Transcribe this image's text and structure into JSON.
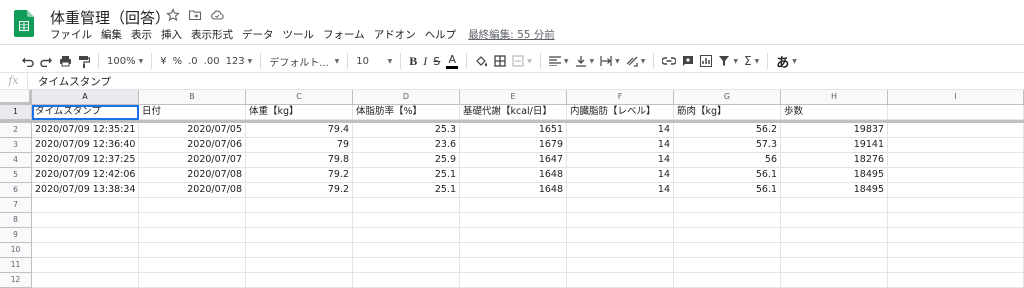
{
  "app": {
    "title": "体重管理（回答）",
    "accent_color": "#0f9d58"
  },
  "menu": {
    "items": [
      "ファイル",
      "編集",
      "表示",
      "挿入",
      "表示形式",
      "データ",
      "ツール",
      "フォーム",
      "アドオン",
      "ヘルプ"
    ],
    "last_edit": "最終編集: 55 分前"
  },
  "toolbar": {
    "zoom": "100%",
    "currency": "¥",
    "percent": "%",
    "decimal_dec": ".0",
    "decimal_inc": ".00",
    "format_more": "123",
    "font": "デフォルト...",
    "font_size": "10",
    "bold": "B",
    "italic": "I",
    "strike": "S",
    "text_color": "A",
    "input_tools": "あ"
  },
  "formula_bar": {
    "fx": "fx",
    "value": "タイムスタンプ"
  },
  "sheet": {
    "columns": [
      "A",
      "B",
      "C",
      "D",
      "E",
      "F",
      "G",
      "H",
      "I"
    ],
    "header_row": [
      "タイムスタンプ",
      "日付",
      "体重【kg】",
      "体脂肪率【%】",
      "基礎代謝【kcal/日】",
      "内臓脂肪【レベル】",
      "筋肉【kg】",
      "歩数",
      ""
    ],
    "rows": [
      [
        "2020/07/09 12:35:21",
        "2020/07/05",
        "79.4",
        "25.3",
        "1651",
        "14",
        "56.2",
        "19837",
        ""
      ],
      [
        "2020/07/09 12:36:40",
        "2020/07/06",
        "79",
        "23.6",
        "1679",
        "14",
        "57.3",
        "19141",
        ""
      ],
      [
        "2020/07/09 12:37:25",
        "2020/07/07",
        "79.8",
        "25.9",
        "1647",
        "14",
        "56",
        "18276",
        ""
      ],
      [
        "2020/07/09 12:42:06",
        "2020/07/08",
        "79.2",
        "25.1",
        "1648",
        "14",
        "56.1",
        "18495",
        ""
      ],
      [
        "2020/07/09 13:38:34",
        "2020/07/08",
        "79.2",
        "25.1",
        "1648",
        "14",
        "56.1",
        "18495",
        ""
      ]
    ],
    "row_numbers": [
      "1",
      "2",
      "3",
      "4",
      "5",
      "6",
      "7",
      "8",
      "9",
      "10",
      "11",
      "12"
    ]
  }
}
